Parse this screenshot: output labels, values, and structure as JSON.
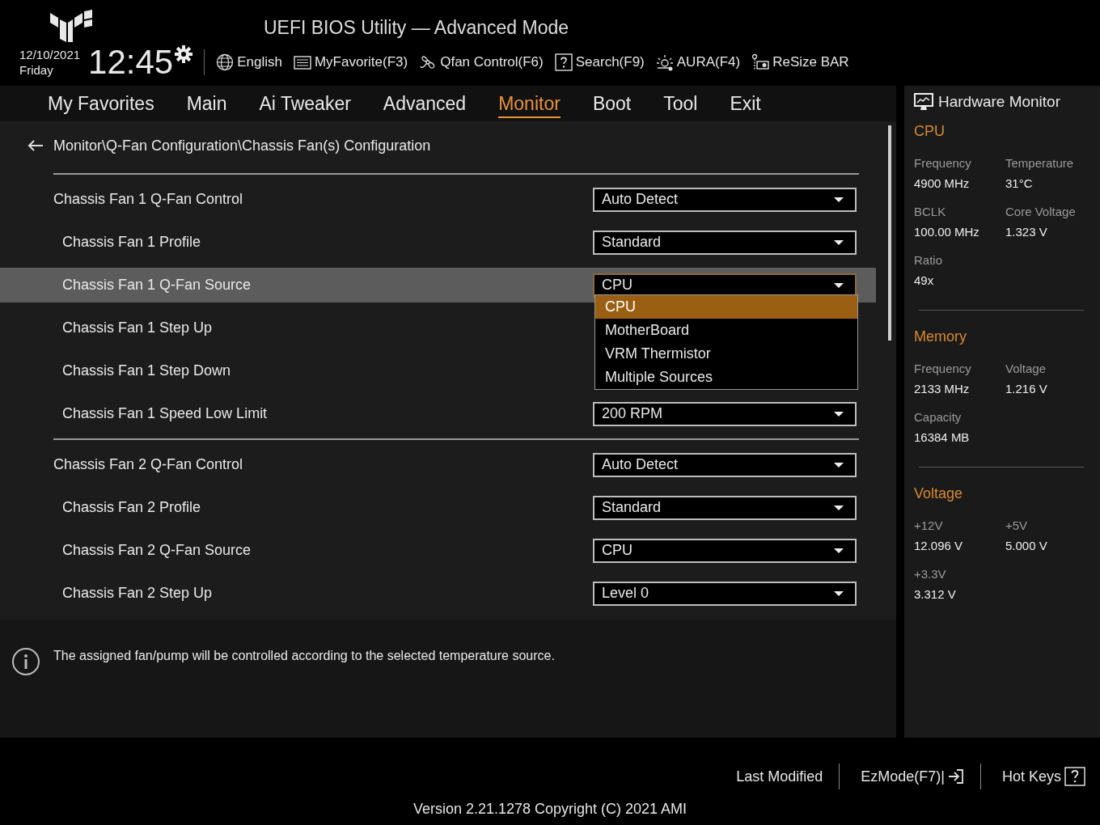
{
  "header": {
    "title": "UEFI BIOS Utility — Advanced Mode",
    "date": "12/10/2021",
    "day": "Friday",
    "time": "12:45",
    "tools": [
      {
        "label": "English"
      },
      {
        "label": "MyFavorite(F3)"
      },
      {
        "label": "Qfan Control(F6)"
      },
      {
        "label": "Search(F9)"
      },
      {
        "label": "AURA(F4)"
      },
      {
        "label": "ReSize BAR"
      }
    ]
  },
  "nav_tabs": [
    {
      "label": "My Favorites",
      "selected": false
    },
    {
      "label": "Main",
      "selected": false
    },
    {
      "label": "Ai Tweaker",
      "selected": false
    },
    {
      "label": "Advanced",
      "selected": false
    },
    {
      "label": "Monitor",
      "selected": true
    },
    {
      "label": "Boot",
      "selected": false
    },
    {
      "label": "Tool",
      "selected": false
    },
    {
      "label": "Exit",
      "selected": false
    }
  ],
  "breadcrumb": "Monitor\\Q-Fan Configuration\\Chassis Fan(s) Configuration",
  "groups": [
    {
      "rows": [
        {
          "kind": "main",
          "label": "Chassis Fan 1 Q-Fan Control",
          "value": "Auto Detect",
          "selected": false
        },
        {
          "kind": "sub",
          "label": "Chassis Fan 1 Profile",
          "value": "Standard",
          "selected": false
        },
        {
          "kind": "sub",
          "label": "Chassis Fan 1 Q-Fan Source",
          "value": "CPU",
          "selected": true,
          "expanded": true,
          "options": [
            {
              "label": "CPU",
              "selected": true
            },
            {
              "label": "MotherBoard",
              "selected": false
            },
            {
              "label": "VRM Thermistor",
              "selected": false
            },
            {
              "label": "Multiple Sources",
              "selected": false
            }
          ]
        },
        {
          "kind": "sub",
          "label": "Chassis Fan 1 Step Up",
          "selected": false
        },
        {
          "kind": "sub",
          "label": "Chassis Fan 1 Step Down",
          "selected": false
        },
        {
          "kind": "sub",
          "label": "Chassis Fan 1 Speed Low Limit",
          "value": "200 RPM",
          "selected": false
        }
      ]
    },
    {
      "rows": [
        {
          "kind": "main",
          "label": "Chassis Fan 2 Q-Fan Control",
          "value": "Auto Detect",
          "selected": false
        },
        {
          "kind": "sub",
          "label": "Chassis Fan 2 Profile",
          "value": "Standard",
          "selected": false
        },
        {
          "kind": "sub",
          "label": "Chassis Fan 2 Q-Fan Source",
          "value": "CPU",
          "selected": false
        },
        {
          "kind": "sub",
          "label": "Chassis Fan 2 Step Up",
          "value": "Level 0",
          "selected": false
        }
      ]
    }
  ],
  "help_text": "The assigned fan/pump will be controlled according to the selected temperature source.",
  "hardware_monitor": {
    "title": "Hardware Monitor",
    "sections": [
      {
        "title": "CPU",
        "items": [
          {
            "label": "Frequency",
            "value": "4900 MHz"
          },
          {
            "label": "Temperature",
            "value": "31°C"
          },
          {
            "label": "BCLK",
            "value": "100.00 MHz"
          },
          {
            "label": "Core Voltage",
            "value": "1.323 V"
          },
          {
            "label": "Ratio",
            "value": "49x"
          }
        ]
      },
      {
        "title": "Memory",
        "items": [
          {
            "label": "Frequency",
            "value": "2133 MHz"
          },
          {
            "label": "Voltage",
            "value": "1.216 V"
          },
          {
            "label": "Capacity",
            "value": "16384 MB"
          }
        ]
      },
      {
        "title": "Voltage",
        "items": [
          {
            "label": "+12V",
            "value": "12.096 V"
          },
          {
            "label": "+5V",
            "value": "5.000 V"
          },
          {
            "label": "+3.3V",
            "value": "3.312 V"
          }
        ]
      }
    ]
  },
  "footer": {
    "buttons": [
      {
        "label": "Last Modified"
      },
      {
        "label": "EzMode(F7)|"
      },
      {
        "label": "Hot Keys"
      }
    ],
    "version": "Version 2.21.1278 Copyright (C) 2021 AMI"
  }
}
